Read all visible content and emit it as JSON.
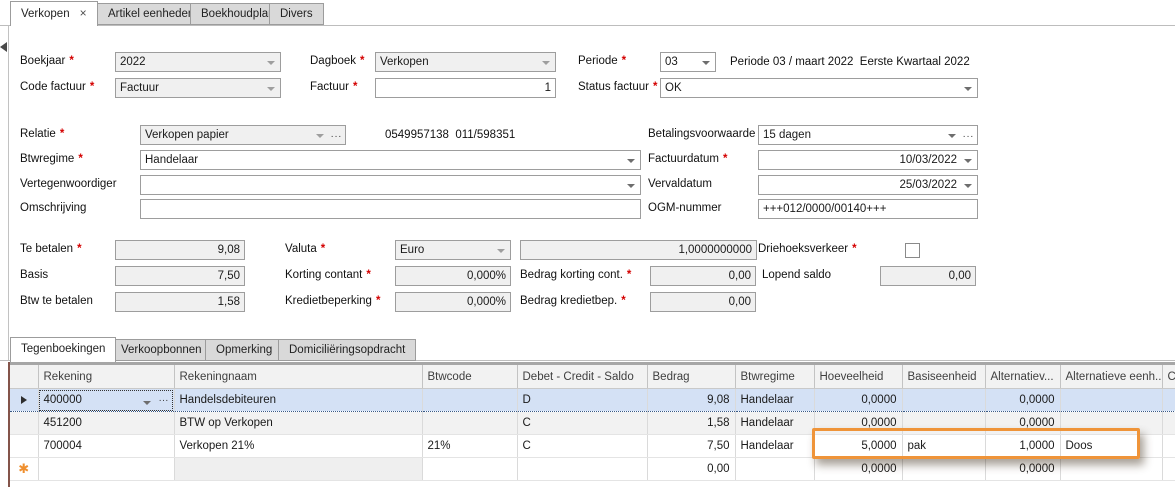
{
  "ui": {
    "required_marker": "*"
  },
  "icons": {
    "close": "×",
    "ellipsis": "···"
  },
  "colors": {
    "highlight_orange": "#EF9439",
    "selection_blue": "#D4E1F5",
    "required_red": "#D40000"
  },
  "tabs_top": {
    "verkopen": "Verkopen",
    "artikel_eenheden": "Artikel eenheden",
    "boekhoudplan": "Boekhoudplan",
    "divers": "Divers"
  },
  "form": {
    "boekjaar": {
      "label": "Boekjaar",
      "value": "2022"
    },
    "dagboek": {
      "label": "Dagboek",
      "value": "Verkopen"
    },
    "periode": {
      "label": "Periode",
      "value": "03",
      "info": "Periode 03 / maart 2022  Eerste Kwartaal 2022"
    },
    "code_factuur": {
      "label": "Code factuur",
      "value": "Factuur"
    },
    "factuur": {
      "label": "Factuur",
      "value": "1"
    },
    "status_factuur": {
      "label": "Status factuur",
      "value": "OK"
    },
    "relatie": {
      "label": "Relatie",
      "value": "Verkopen papier",
      "info": "0549957138  011/598351"
    },
    "betalingsvoorwaarde": {
      "label": "Betalingsvoorwaarde",
      "value": "15 dagen"
    },
    "btwregime": {
      "label": "Btwregime",
      "value": "Handelaar"
    },
    "factuurdatum": {
      "label": "Factuurdatum",
      "value": "10/03/2022"
    },
    "vertegenwoordiger": {
      "label": "Vertegenwoordiger",
      "value": ""
    },
    "vervaldatum": {
      "label": "Vervaldatum",
      "value": "25/03/2022"
    },
    "omschrijving": {
      "label": "Omschrijving",
      "value": ""
    },
    "ogm_nummer": {
      "label": "OGM-nummer",
      "value": "+++012/0000/00140+++"
    },
    "te_betalen": {
      "label": "Te betalen",
      "value": "9,08"
    },
    "valuta": {
      "label": "Valuta",
      "value": "Euro",
      "rate": "1,0000000000"
    },
    "driehoeksverkeer": {
      "label": "Driehoeksverkeer",
      "checked": false
    },
    "basis": {
      "label": "Basis",
      "value": "7,50"
    },
    "korting_contant": {
      "label": "Korting contant",
      "value": "0,000%"
    },
    "bedrag_korting_cont": {
      "label": "Bedrag korting cont.",
      "value": "0,00"
    },
    "lopend_saldo": {
      "label": "Lopend saldo",
      "value": "0,00"
    },
    "btw_te_betalen": {
      "label": "Btw te betalen",
      "value": "1,58"
    },
    "kredietbeperking": {
      "label": "Kredietbeperking",
      "value": "0,000%"
    },
    "bedrag_kredietbep": {
      "label": "Bedrag kredietbep.",
      "value": "0,00"
    }
  },
  "tabs_bottom": {
    "tegenboekingen": "Tegenboekingen",
    "verkoopbonnen": "Verkoopbonnen",
    "opmerking": "Opmerking",
    "domicilieringsopdracht": "Domiciliëringsopdracht"
  },
  "table": {
    "new_row_glyph": "✱",
    "columns": {
      "rekening": "Rekening",
      "rekeningnaam": "Rekeningnaam",
      "btwcode": "Btwcode",
      "dcs": "Debet - Credit - Saldo",
      "bedrag": "Bedrag",
      "btwregime": "Btwregime",
      "hoeveelheid": "Hoeveelheid",
      "basiseenheid": "Basiseenheid",
      "alternatief": "Alternatiev...",
      "alternatieve_eenheid": "Alternatieve eenh...",
      "c": "C"
    },
    "rows": [
      {
        "rekening": "400000",
        "rekeningnaam": "Handelsdebiteuren",
        "btwcode": "",
        "dcs": "D",
        "bedrag": "9,08",
        "btwregime": "Handelaar",
        "hoeveelheid": "0,0000",
        "basiseenheid": "",
        "alternatief": "0,0000",
        "alternatieve_eenheid": ""
      },
      {
        "rekening": "451200",
        "rekeningnaam": "BTW op Verkopen",
        "btwcode": "",
        "dcs": "C",
        "bedrag": "1,58",
        "btwregime": "Handelaar",
        "hoeveelheid": "0,0000",
        "basiseenheid": "",
        "alternatief": "0,0000",
        "alternatieve_eenheid": ""
      },
      {
        "rekening": "700004",
        "rekeningnaam": "Verkopen 21%",
        "btwcode": "21%",
        "dcs": "C",
        "bedrag": "7,50",
        "btwregime": "Handelaar",
        "hoeveelheid": "5,0000",
        "basiseenheid": "pak",
        "alternatief": "1,0000",
        "alternatieve_eenheid": "Doos"
      },
      {
        "rekening": "",
        "rekeningnaam": "",
        "btwcode": "",
        "dcs": "",
        "bedrag": "0,00",
        "btwregime": "",
        "hoeveelheid": "0,0000",
        "basiseenheid": "",
        "alternatief": "0,0000",
        "alternatieve_eenheid": ""
      }
    ]
  }
}
